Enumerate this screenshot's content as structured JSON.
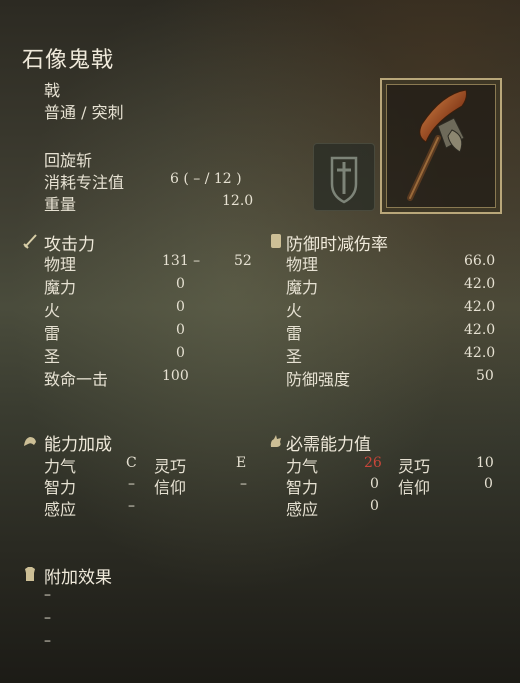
{
  "weapon": {
    "name": "石像鬼戟",
    "type": "戟",
    "damage_type": "普通 / 突刺",
    "skill": "回旋斩",
    "fp_label": "消耗专注值",
    "fp_value": "6 (  – /  12 )",
    "weight_label": "重量",
    "weight_value": "12.0"
  },
  "attack": {
    "header": "攻击力",
    "rows": [
      {
        "label": "物理",
        "value": "131 –",
        "extra": "52"
      },
      {
        "label": "魔力",
        "value": "0"
      },
      {
        "label": "火",
        "value": "0"
      },
      {
        "label": "雷",
        "value": "0"
      },
      {
        "label": "圣",
        "value": "0"
      },
      {
        "label": "致命一击",
        "value": "100"
      }
    ]
  },
  "guard": {
    "header": "防御时减伤率",
    "rows": [
      {
        "label": "物理",
        "value": "66.0"
      },
      {
        "label": "魔力",
        "value": "42.0"
      },
      {
        "label": "火",
        "value": "42.0"
      },
      {
        "label": "雷",
        "value": "42.0"
      },
      {
        "label": "圣",
        "value": "42.0"
      },
      {
        "label": "防御强度",
        "value": "50"
      }
    ]
  },
  "scaling": {
    "header": "能力加成",
    "rows": [
      {
        "label": "力气",
        "value": "C",
        "label2": "灵巧",
        "value2": "E"
      },
      {
        "label": "智力",
        "value": "–",
        "label2": "信仰",
        "value2": "–"
      },
      {
        "label": "感应",
        "value": "–"
      }
    ]
  },
  "requirements": {
    "header": "必需能力值",
    "rows": [
      {
        "label": "力气",
        "value": "26",
        "label2": "灵巧",
        "value2": "10"
      },
      {
        "label": "智力",
        "value": "0",
        "label2": "信仰",
        "value2": "0"
      },
      {
        "label": "感应",
        "value": "0"
      }
    ]
  },
  "effects": {
    "header": "附加效果",
    "items": [
      "–",
      "–",
      "–"
    ]
  },
  "colors": {
    "insufficient": "#c8463a",
    "frame": "#b9a77a"
  }
}
